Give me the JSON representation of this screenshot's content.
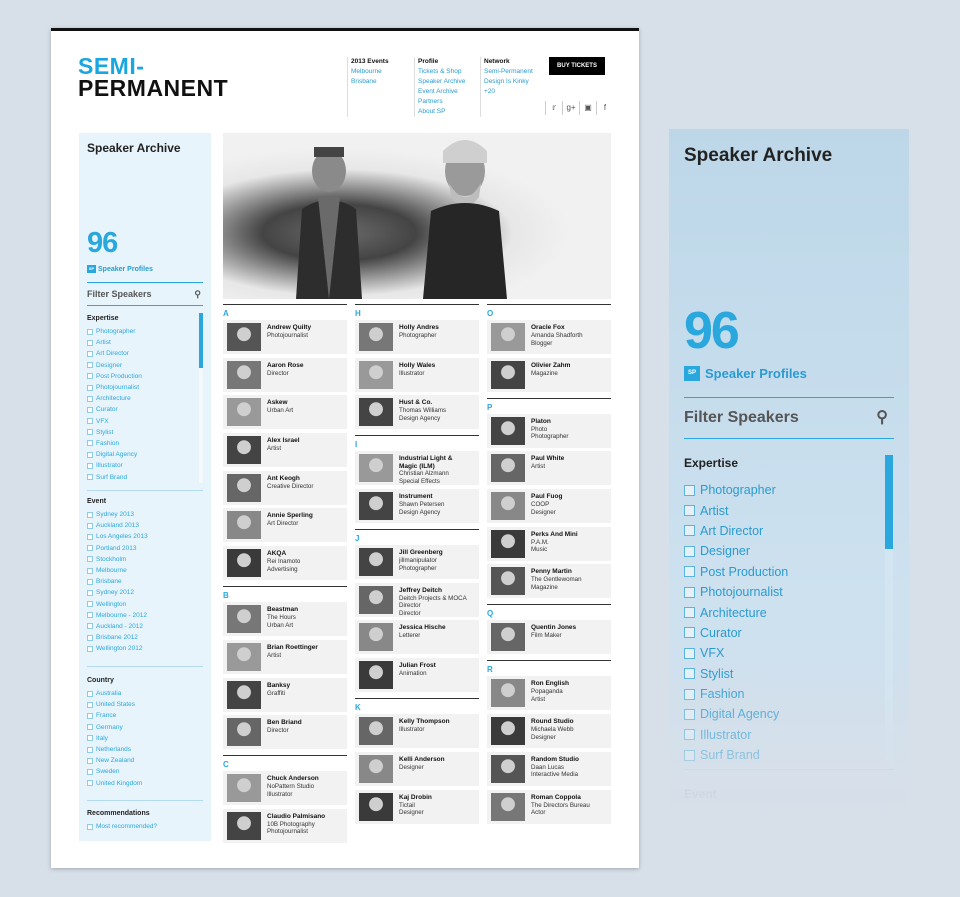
{
  "header": {
    "logo_line1": "SEMI-",
    "logo_line2": "PERMANENT",
    "nav": [
      {
        "title": "2013 Events",
        "items": [
          "Melbourne",
          "Brisbane"
        ]
      },
      {
        "title": "Profile",
        "items": [
          "Tickets & Shop",
          "Speaker Archive",
          "Event Archive",
          "Partners",
          "About SP"
        ]
      },
      {
        "title": "Network",
        "items": [
          "Semi-Permanent",
          "Design Is Kinky",
          "+20"
        ]
      }
    ],
    "buy_label": "BUY TICKETS",
    "social": [
      "twitter-icon",
      "google-plus-icon",
      "instagram-icon",
      "facebook-icon"
    ]
  },
  "sidebar": {
    "title": "Speaker Archive",
    "count": "96",
    "profiles_badge": "SP",
    "profiles_label": "Speaker Profiles",
    "filter_label": "Filter Speakers",
    "expertise_title": "Expertise",
    "expertise": [
      "Photographer",
      "Artist",
      "Art Director",
      "Designer",
      "Post Production",
      "Photojournalist",
      "Architecture",
      "Curator",
      "VFX",
      "Stylist",
      "Fashion",
      "Digital Agency",
      "Illustrator",
      "Surf Brand"
    ],
    "event_title": "Event",
    "events": [
      "Sydney 2013",
      "Auckland 2013",
      "Los Angeles 2013",
      "Portland 2013",
      "Stockholm",
      "Melbourne",
      "Brisbane",
      "Sydney 2012",
      "Wellington",
      "Melbourne - 2012",
      "Auckland - 2012",
      "Brisbane 2012",
      "Wellington 2012"
    ],
    "country_title": "Country",
    "countries": [
      "Australia",
      "United States",
      "France",
      "Germany",
      "Italy",
      "Netherlands",
      "New Zealand",
      "Sweden",
      "United Kingdom"
    ],
    "recommend_title": "Recommendations",
    "recommend": [
      "Most recommended?"
    ]
  },
  "columns": [
    [
      {
        "letter": "A",
        "speakers": [
          {
            "name": "Andrew Quilty",
            "sub": "Photojournalist"
          },
          {
            "name": "Aaron Rose",
            "sub": "Director"
          },
          {
            "name": "Askew",
            "sub": "Urban Art"
          },
          {
            "name": "Alex Israel",
            "sub": "Artist"
          },
          {
            "name": "Ant Keogh",
            "sub": "Creative Director"
          },
          {
            "name": "Annie Sperling",
            "sub": "Art Director"
          },
          {
            "name": "AKQA",
            "sub": "Rei Inamoto\nAdvertising"
          }
        ]
      },
      {
        "letter": "B",
        "speakers": [
          {
            "name": "Beastman",
            "sub": "The Hours\nUrban Art"
          },
          {
            "name": "Brian Roettinger",
            "sub": "Artist"
          },
          {
            "name": "Banksy",
            "sub": "Graffiti"
          },
          {
            "name": "Ben Briand",
            "sub": "Director"
          }
        ]
      },
      {
        "letter": "C",
        "speakers": [
          {
            "name": "Chuck Anderson",
            "sub": "NoPattern Studio\nIllustrator"
          },
          {
            "name": "Claudio Palmisano",
            "sub": "10B Photography\nPhotojournalist"
          }
        ]
      }
    ],
    [
      {
        "letter": "H",
        "speakers": [
          {
            "name": "Holly Andres",
            "sub": "Photographer"
          },
          {
            "name": "Holly Wales",
            "sub": "Illustrator"
          },
          {
            "name": "Hust & Co.",
            "sub": "Thomas Williams\nDesign Agency"
          }
        ]
      },
      {
        "letter": "I",
        "speakers": [
          {
            "name": "Industrial Light &\nMagic (ILM)",
            "sub": "Christian Alzmann\nSpecial Effects"
          },
          {
            "name": "Instrument",
            "sub": "Shawn Petersen\nDesign Agency"
          }
        ]
      },
      {
        "letter": "J",
        "speakers": [
          {
            "name": "Jill Greenberg",
            "sub": "jillmanipulator\nPhotographer"
          },
          {
            "name": "Jeffrey Deitch",
            "sub": "Deitch Projects & MOCA\nDirector\nDirector"
          },
          {
            "name": "Jessica Hische",
            "sub": "Letterer"
          },
          {
            "name": "Julian Frost",
            "sub": "Animation"
          }
        ]
      },
      {
        "letter": "K",
        "speakers": [
          {
            "name": "Kelly Thompson",
            "sub": "Illustrator"
          },
          {
            "name": "Kelli Anderson",
            "sub": "Designer"
          },
          {
            "name": "Kaj Drobin",
            "sub": "Tictail\nDesigner"
          }
        ]
      }
    ],
    [
      {
        "letter": "O",
        "speakers": [
          {
            "name": "Oracle Fox",
            "sub": "Amanda Shadforth\nBlogger"
          },
          {
            "name": "Olivier Zahm",
            "sub": "Magazine"
          }
        ]
      },
      {
        "letter": "P",
        "speakers": [
          {
            "name": "Platon",
            "sub": "Photo\nPhotographer"
          },
          {
            "name": "Paul White",
            "sub": "Artist"
          },
          {
            "name": "Paul Fuog",
            "sub": "COOP\nDesigner"
          },
          {
            "name": "Perks And Mini",
            "sub": "P.A.M.\nMusic"
          },
          {
            "name": "Penny Martin",
            "sub": "The Gentlewoman\nMagazine"
          }
        ]
      },
      {
        "letter": "Q",
        "speakers": [
          {
            "name": "Quentin Jones",
            "sub": "Film Maker"
          }
        ]
      },
      {
        "letter": "R",
        "speakers": [
          {
            "name": "Ron English",
            "sub": "Popaganda\nArtist"
          },
          {
            "name": "Round Studio",
            "sub": "Michaela Webb\nDesigner"
          },
          {
            "name": "Random Studio",
            "sub": "Daan Lucas\nInteractive Media"
          },
          {
            "name": "Roman Coppola",
            "sub": "The Directors Bureau\nActor"
          }
        ]
      }
    ]
  ],
  "colors": {
    "accent": "#2aa8de",
    "sidebar_bg": "#e8f4fb"
  }
}
